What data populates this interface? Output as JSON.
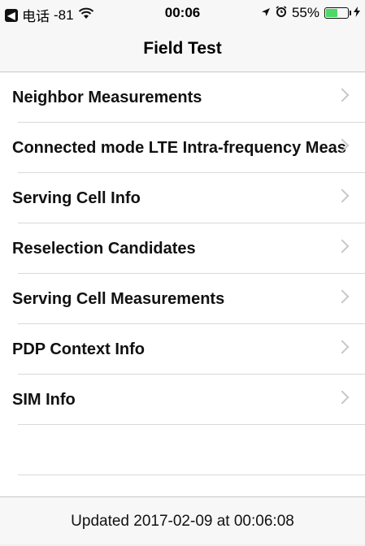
{
  "status_bar": {
    "carrier": "电话",
    "signal": "-81",
    "time": "00:06",
    "battery_percent": "55%",
    "battery_level": 0.55,
    "icons": [
      "back-badge",
      "wifi-icon",
      "location-arrow-icon",
      "alarm-icon",
      "battery-icon",
      "charging-bolt-icon"
    ],
    "colors": {
      "battery_fill": "#4cd964"
    }
  },
  "nav": {
    "title": "Field Test"
  },
  "list": {
    "items": [
      {
        "label": "Neighbor Measurements"
      },
      {
        "label": "Connected mode LTE Intra-frequency Meas"
      },
      {
        "label": "Serving Cell Info"
      },
      {
        "label": "Reselection Candidates"
      },
      {
        "label": "Serving Cell Measurements"
      },
      {
        "label": "PDP Context Info"
      },
      {
        "label": "SIM Info"
      }
    ]
  },
  "footer": {
    "text": "Updated 2017-02-09 at 00:06:08"
  }
}
